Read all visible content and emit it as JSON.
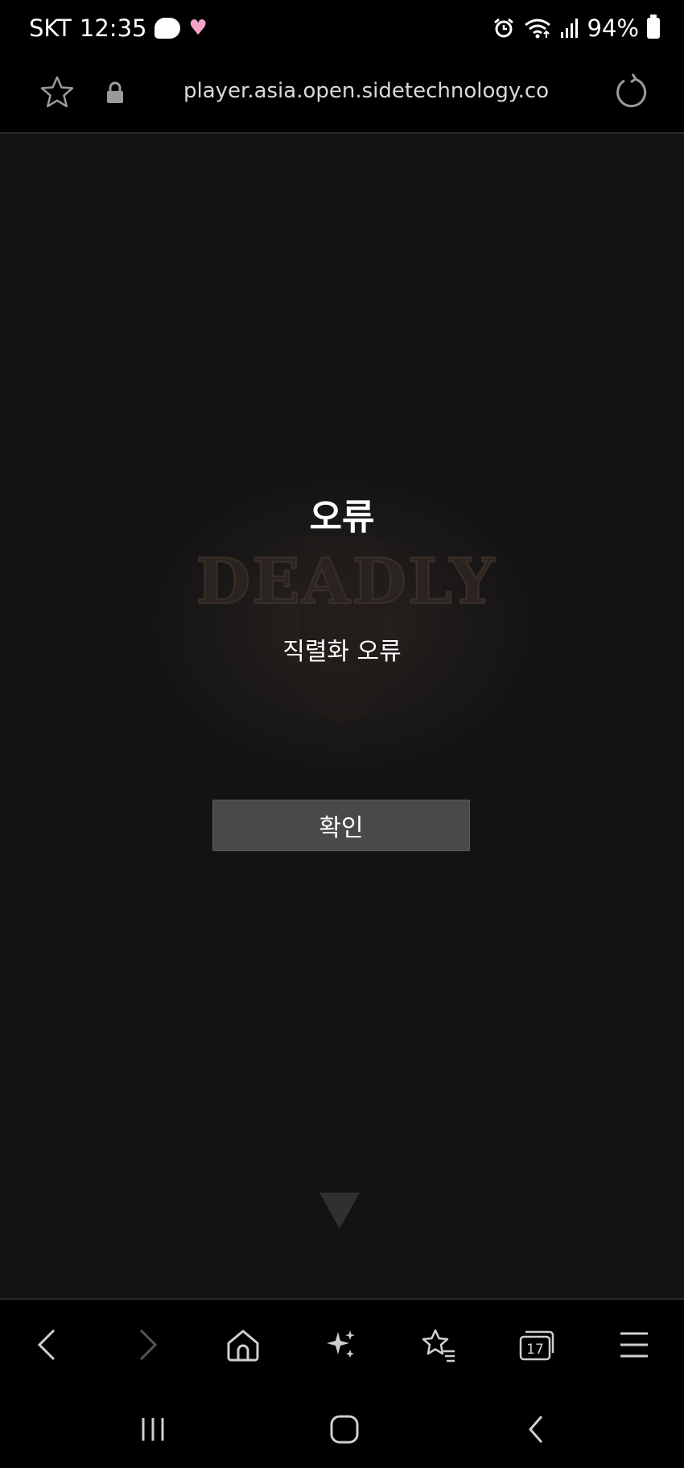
{
  "status_bar": {
    "carrier": "SKT",
    "time": "12:35",
    "battery_percent": "94%"
  },
  "browser": {
    "url": "player.asia.open.sidetechnology.co",
    "tab_count": "17"
  },
  "dialog": {
    "title": "오류",
    "message": "직렬화 오류",
    "confirm_label": "확인"
  },
  "colors": {
    "background": "#141314",
    "button": "#4b4849",
    "text": "#ffffff"
  },
  "icons": {
    "status": [
      "bubble-icon",
      "heart-icon",
      "alarm-icon",
      "wifi-icon",
      "signal-icon",
      "battery-icon"
    ],
    "url_bar": [
      "star-icon",
      "lock-icon",
      "reload-icon"
    ],
    "toolbar": [
      "back-icon",
      "forward-icon",
      "home-icon",
      "sparkle-icon",
      "bookmarks-icon",
      "tabs-icon",
      "menu-icon"
    ],
    "nav": [
      "recents-icon",
      "home-nav-icon",
      "back-nav-icon"
    ]
  }
}
